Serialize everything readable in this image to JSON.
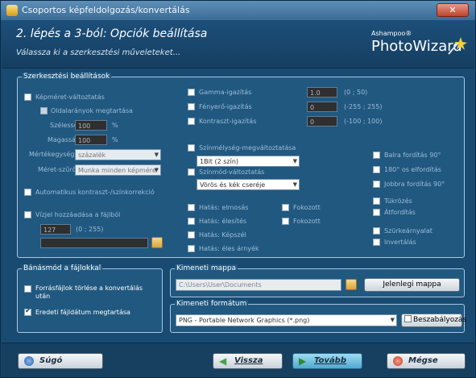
{
  "window": {
    "title": "Csoportos képfeldolgozás/konvertálás",
    "close": "✕"
  },
  "header": {
    "step": "2. lépés a 3-ból: Opciók beállítása",
    "subtitle": "Válassza ki a szerkesztési műveleteket...",
    "brand_small": "Ashampoo®",
    "brand_big": "PhotoWizard"
  },
  "edit_settings": {
    "title": "Szerkesztési beállítások",
    "resize": {
      "label": "Képméret-változtatás",
      "checked": false
    },
    "keep_ratio": {
      "label": "Oldalarányok megtartása",
      "checked": false
    },
    "width": {
      "label": "Szélesség:",
      "value": "100",
      "unit": "%"
    },
    "height": {
      "label": "Magasság:",
      "value": "100",
      "unit": "%"
    },
    "unit": {
      "label": "Mértékegység:",
      "value": "százalék"
    },
    "resize_filter": {
      "label": "Méret-szűrő:",
      "value": "Munka minden képmére"
    },
    "auto_contrast": {
      "label": "Automatikus kontraszt-/színkorrekció",
      "checked": false
    },
    "watermark": {
      "label": "Vízjel hozzáadása a fájlból",
      "checked": false,
      "value": "127",
      "range": "(0 ; 255)",
      "path": ""
    },
    "gamma": {
      "label": "Gamma-igazítás",
      "value": "1.0",
      "range": "(0 ; 50)"
    },
    "brightness": {
      "label": "Fényerő-igazítás",
      "value": "0",
      "range": "(-255 ; 255)"
    },
    "contrast": {
      "label": "Kontraszt-igazítás",
      "value": "0",
      "range": "(-100 ; 100)"
    },
    "color_depth": {
      "label": "Színmélység-megváltoztatása",
      "value": "1Bit (2 szín)"
    },
    "color_mode": {
      "label": "Színmód-változtatás",
      "value": "Vörös és kék cseréje"
    },
    "effects": [
      {
        "label": "Hatás: elmosás"
      },
      {
        "label": "Hatás: élesítés"
      },
      {
        "label": "Hatás: Képszél"
      },
      {
        "label": "Hatás: éles árnyék"
      }
    ],
    "effects2": [
      {
        "label": "Fokozott"
      },
      {
        "label": "Fokozott"
      }
    ],
    "rotations": [
      {
        "label": "Balra fordítás 90°"
      },
      {
        "label": "180° os elfordítás"
      },
      {
        "label": "Jobbra fordítás 90°"
      }
    ],
    "flips": [
      {
        "label": "Tükrözés"
      },
      {
        "label": "Átfordítás"
      }
    ],
    "misc": [
      {
        "label": "Szürkeárnyalat"
      },
      {
        "label": "Invertálás"
      }
    ]
  },
  "file_handling": {
    "title": "Bánásmód a fájlokkal",
    "delete_after": {
      "label": "Forrásfájlok törlése a konvertálás után",
      "checked": false
    },
    "keep_date": {
      "label": "Eredeti fájldátum megtartása",
      "checked": true
    }
  },
  "output_folder": {
    "title": "Kimeneti mappa",
    "path": "C:\\Users\\User\\Documents",
    "current_button": "Jelenlegi mappa"
  },
  "output_format": {
    "title": "Kimeneti formátum",
    "value": "PNG - Portable Network Graphics (*.png)",
    "settings_button": "Beszabályozás"
  },
  "nav": {
    "help": "Súgó",
    "back": "Vissza",
    "next": "Tovább",
    "cancel": "Mégse"
  }
}
